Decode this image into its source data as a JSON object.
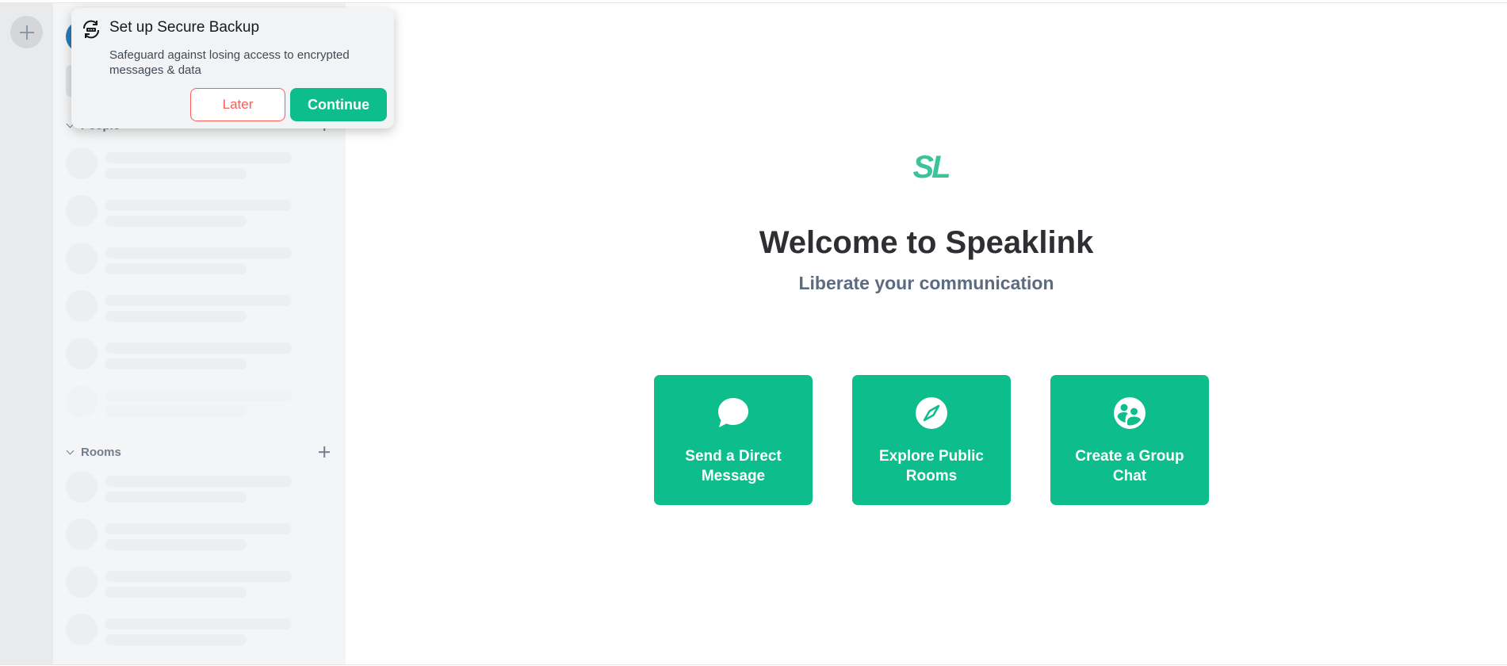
{
  "toast": {
    "title": "Set up Secure Backup",
    "description": "Safeguard against losing access to encrypted messages & data",
    "later_label": "Later",
    "continue_label": "Continue",
    "icon": "secure-backup-icon"
  },
  "roomlist": {
    "people_label": "People",
    "rooms_label": "Rooms"
  },
  "welcome": {
    "logo": "SL",
    "title": "Welcome to Speaklink",
    "subtitle": "Liberate your communication"
  },
  "tiles": [
    {
      "label": "Send a Direct Message",
      "icon": "chat-bubble-icon"
    },
    {
      "label": "Explore Public Rooms",
      "icon": "compass-icon"
    },
    {
      "label": "Create a Group Chat",
      "icon": "group-icon"
    }
  ],
  "colors": {
    "accent": "#0dbd8b",
    "danger": "#ff5b55",
    "subtitle": "#5b6b82",
    "logo": "#3cc39a"
  }
}
